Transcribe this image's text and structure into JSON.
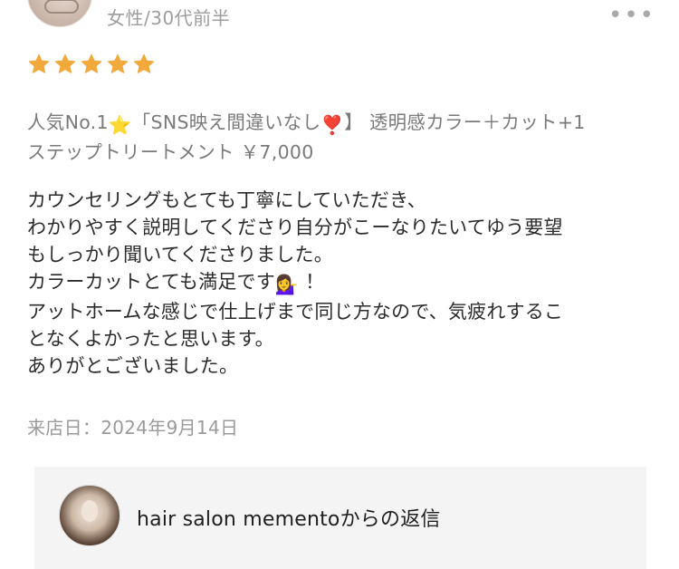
{
  "reviewer": {
    "meta": "女性/30代前半"
  },
  "header": {
    "more_icon": "more-horizontal-icon"
  },
  "rating": {
    "stars": 5,
    "max": 5,
    "color": "#f2a93b"
  },
  "menu": {
    "part1": "人気No.1",
    "part2": "「SNS映え間違いなし",
    "part3": "】 透明感カラー＋カット+1",
    "line2": "ステップトリートメント ￥7,000",
    "star_emoji": "⭐",
    "heart_emoji": "❣️"
  },
  "review": {
    "lines": [
      "カウンセリングもとても丁寧にしていただき、",
      "わかりやすく説明してくださり自分がこーなりたいてゆう要望",
      "もしっかり聞いてくださりました。",
      "カラーカットとても満足です",
      "アットホームな感じで仕上げまで同じ方なので、気疲れするこ",
      "となくよかったと思います。",
      "ありがとございました。"
    ],
    "line4_emoji": "💁‍♀️",
    "line4_suffix": " ！"
  },
  "visit": {
    "label": "来店日：2024年9月14日"
  },
  "reply": {
    "title": "hair salon mementoからの返信"
  }
}
